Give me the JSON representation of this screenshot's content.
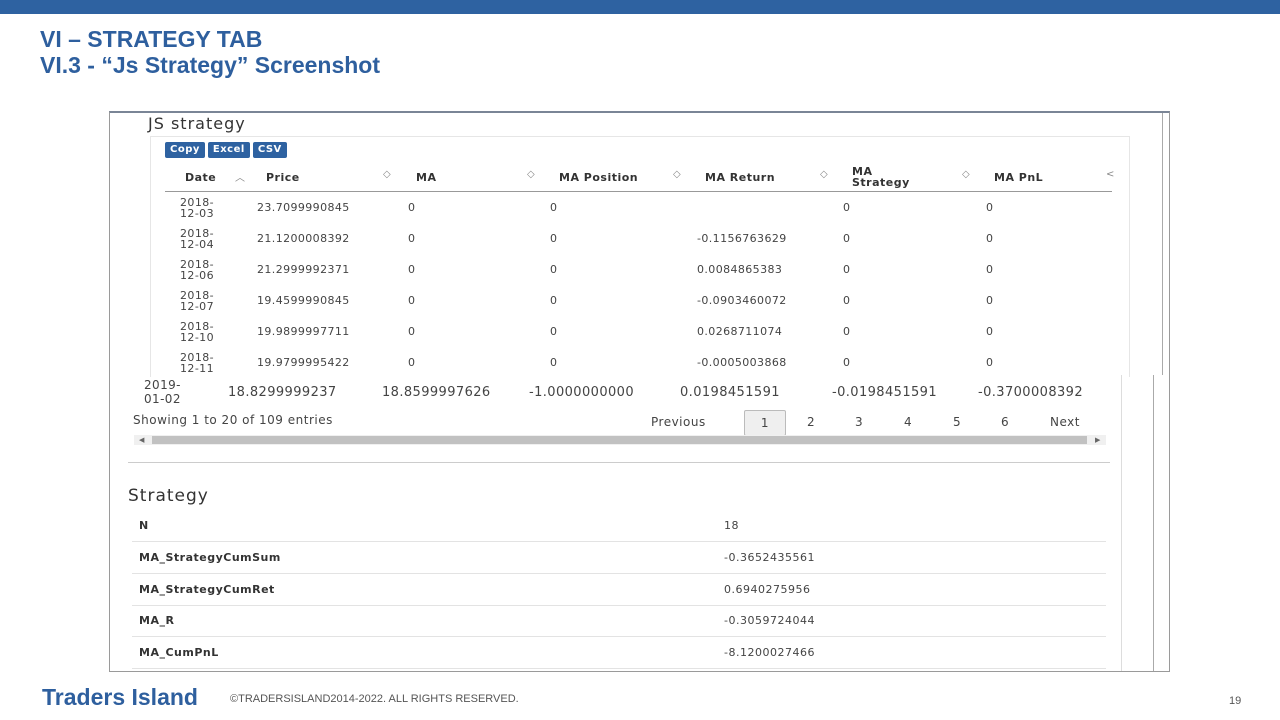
{
  "slide": {
    "title_line1": "VI – STRATEGY TAB",
    "title_line2": "VI.3 - “Js Strategy” Screenshot",
    "footer_brand": "Traders Island",
    "footer_copyright": "©TRADERSISLAND2014-2022. ALL RIGHTS RESERVED.",
    "page_number": "19"
  },
  "js_strategy": {
    "title": "JS strategy",
    "buttons": [
      "Copy",
      "Excel",
      "CSV"
    ],
    "columns": [
      "Date",
      "Price",
      "MA",
      "MA Position",
      "MA Return",
      "MA Strategy",
      "MA PnL"
    ],
    "rows": [
      [
        "2018-12-03",
        "23.7099990845",
        "0",
        "0",
        "",
        "0",
        "0"
      ],
      [
        "2018-12-04",
        "21.1200008392",
        "0",
        "0",
        "-0.1156763629",
        "0",
        "0"
      ],
      [
        "2018-12-06",
        "21.2999992371",
        "0",
        "0",
        "0.0084865383",
        "0",
        "0"
      ],
      [
        "2018-12-07",
        "19.4599990845",
        "0",
        "0",
        "-0.0903460072",
        "0",
        "0"
      ],
      [
        "2018-12-10",
        "19.9899997711",
        "0",
        "0",
        "0.0268711074",
        "0",
        "0"
      ],
      [
        "2018-12-11",
        "19.9799995422",
        "0",
        "0",
        "-0.0005003868",
        "0",
        "0"
      ]
    ],
    "overflow_row": [
      "2019-01-02",
      "18.8299999237",
      "18.8599997626",
      "-1.0000000000",
      "0.0198451591",
      "-0.0198451591",
      "-0.3700008392"
    ],
    "info": "Showing 1 to 20 of 109 entries",
    "pager": {
      "previous": "Previous",
      "pages": [
        "1",
        "2",
        "3",
        "4",
        "5",
        "6"
      ],
      "next": "Next",
      "current": "1"
    }
  },
  "strategy": {
    "title": "Strategy",
    "rows": [
      {
        "name": "N",
        "value": "18"
      },
      {
        "name": "MA_StrategyCumSum",
        "value": "-0.3652435561"
      },
      {
        "name": "MA_StrategyCumRet",
        "value": "0.6940275956"
      },
      {
        "name": "MA_R",
        "value": "-0.3059724044"
      },
      {
        "name": "MA_CumPnL",
        "value": "-8.1200027466"
      }
    ]
  },
  "colors": {
    "brand_blue": "#2e62a1",
    "title_blue": "#2e5f9e"
  }
}
